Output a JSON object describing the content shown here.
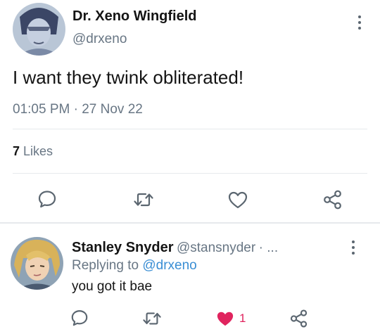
{
  "tweet": {
    "author_name": "Dr. Xeno Wingfield",
    "author_handle": "@drxeno",
    "text": "I want they twink obliterated!",
    "time": "01:05 PM",
    "separator": "·",
    "date": "27 Nov 22",
    "likes_count": "7",
    "likes_label": "Likes"
  },
  "reply": {
    "author_name": "Stanley Snyder",
    "author_handle": "@stansnyder",
    "handle_suffix": "· ...",
    "replying_prefix": "Replying to",
    "replying_handle": "@drxeno",
    "text": "you got it bae",
    "like_count": "1"
  },
  "icons": {
    "reply": "comment-icon",
    "retweet": "retweet-icon",
    "like": "heart-icon",
    "share": "share-icon",
    "more": "more-vertical-icon"
  },
  "colors": {
    "link": "#3a8ed4",
    "muted": "#687684",
    "liked": "#e0245e"
  }
}
